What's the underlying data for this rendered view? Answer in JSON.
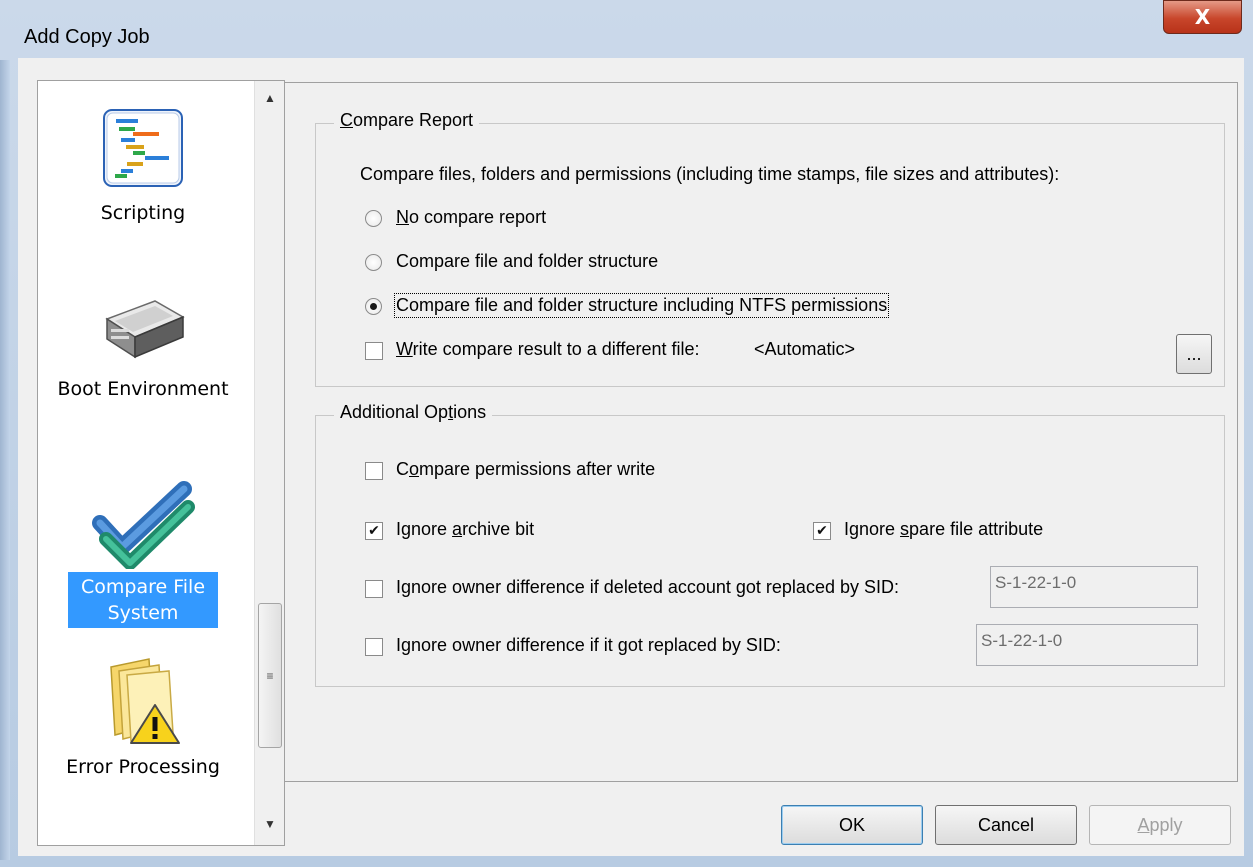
{
  "window": {
    "title": "Add Copy Job",
    "close_label": "X"
  },
  "sidebar": {
    "items": [
      {
        "label": "Scripting",
        "icon": "gantt-chart-icon",
        "selected": false
      },
      {
        "label": "Boot Environment",
        "icon": "disk-drive-icon",
        "selected": false
      },
      {
        "label": "Compare File System",
        "icon": "checkmark-icon",
        "selected": true
      },
      {
        "label": "Error Processing",
        "icon": "folder-warning-icon",
        "selected": false
      }
    ],
    "scroll_up": "▲",
    "scroll_down": "▼",
    "thumb_grip": "≡"
  },
  "compare_report": {
    "title": "Compare Report",
    "description": "Compare files, folders and permissions (including time stamps, file sizes and attributes):",
    "options": [
      {
        "label": "No compare report",
        "selected": false
      },
      {
        "label": "Compare file and folder structure",
        "selected": false
      },
      {
        "label": "Compare file and folder structure including NTFS permissions",
        "selected": true
      }
    ],
    "write_result": {
      "label": "Write compare result to a different file:",
      "checked": false,
      "value": "<Automatic>"
    },
    "browse_label": "..."
  },
  "additional_options": {
    "title": "Additional Options",
    "compare_permissions": {
      "label": "Compare permissions after write",
      "checked": false
    },
    "ignore_archive": {
      "label": "Ignore archive bit",
      "checked": true
    },
    "ignore_spare": {
      "label": "Ignore spare file attribute",
      "checked": true
    },
    "ignore_owner_deleted": {
      "label": "Ignore owner difference if deleted account got replaced by SID:",
      "checked": false,
      "value": "S-1-22-1-0"
    },
    "ignore_owner_replaced": {
      "label": "Ignore owner difference if it got replaced by SID:",
      "checked": false,
      "value": "S-1-22-1-0"
    }
  },
  "buttons": {
    "ok": "OK",
    "cancel": "Cancel",
    "apply": "Apply"
  },
  "check_mark": "✔"
}
